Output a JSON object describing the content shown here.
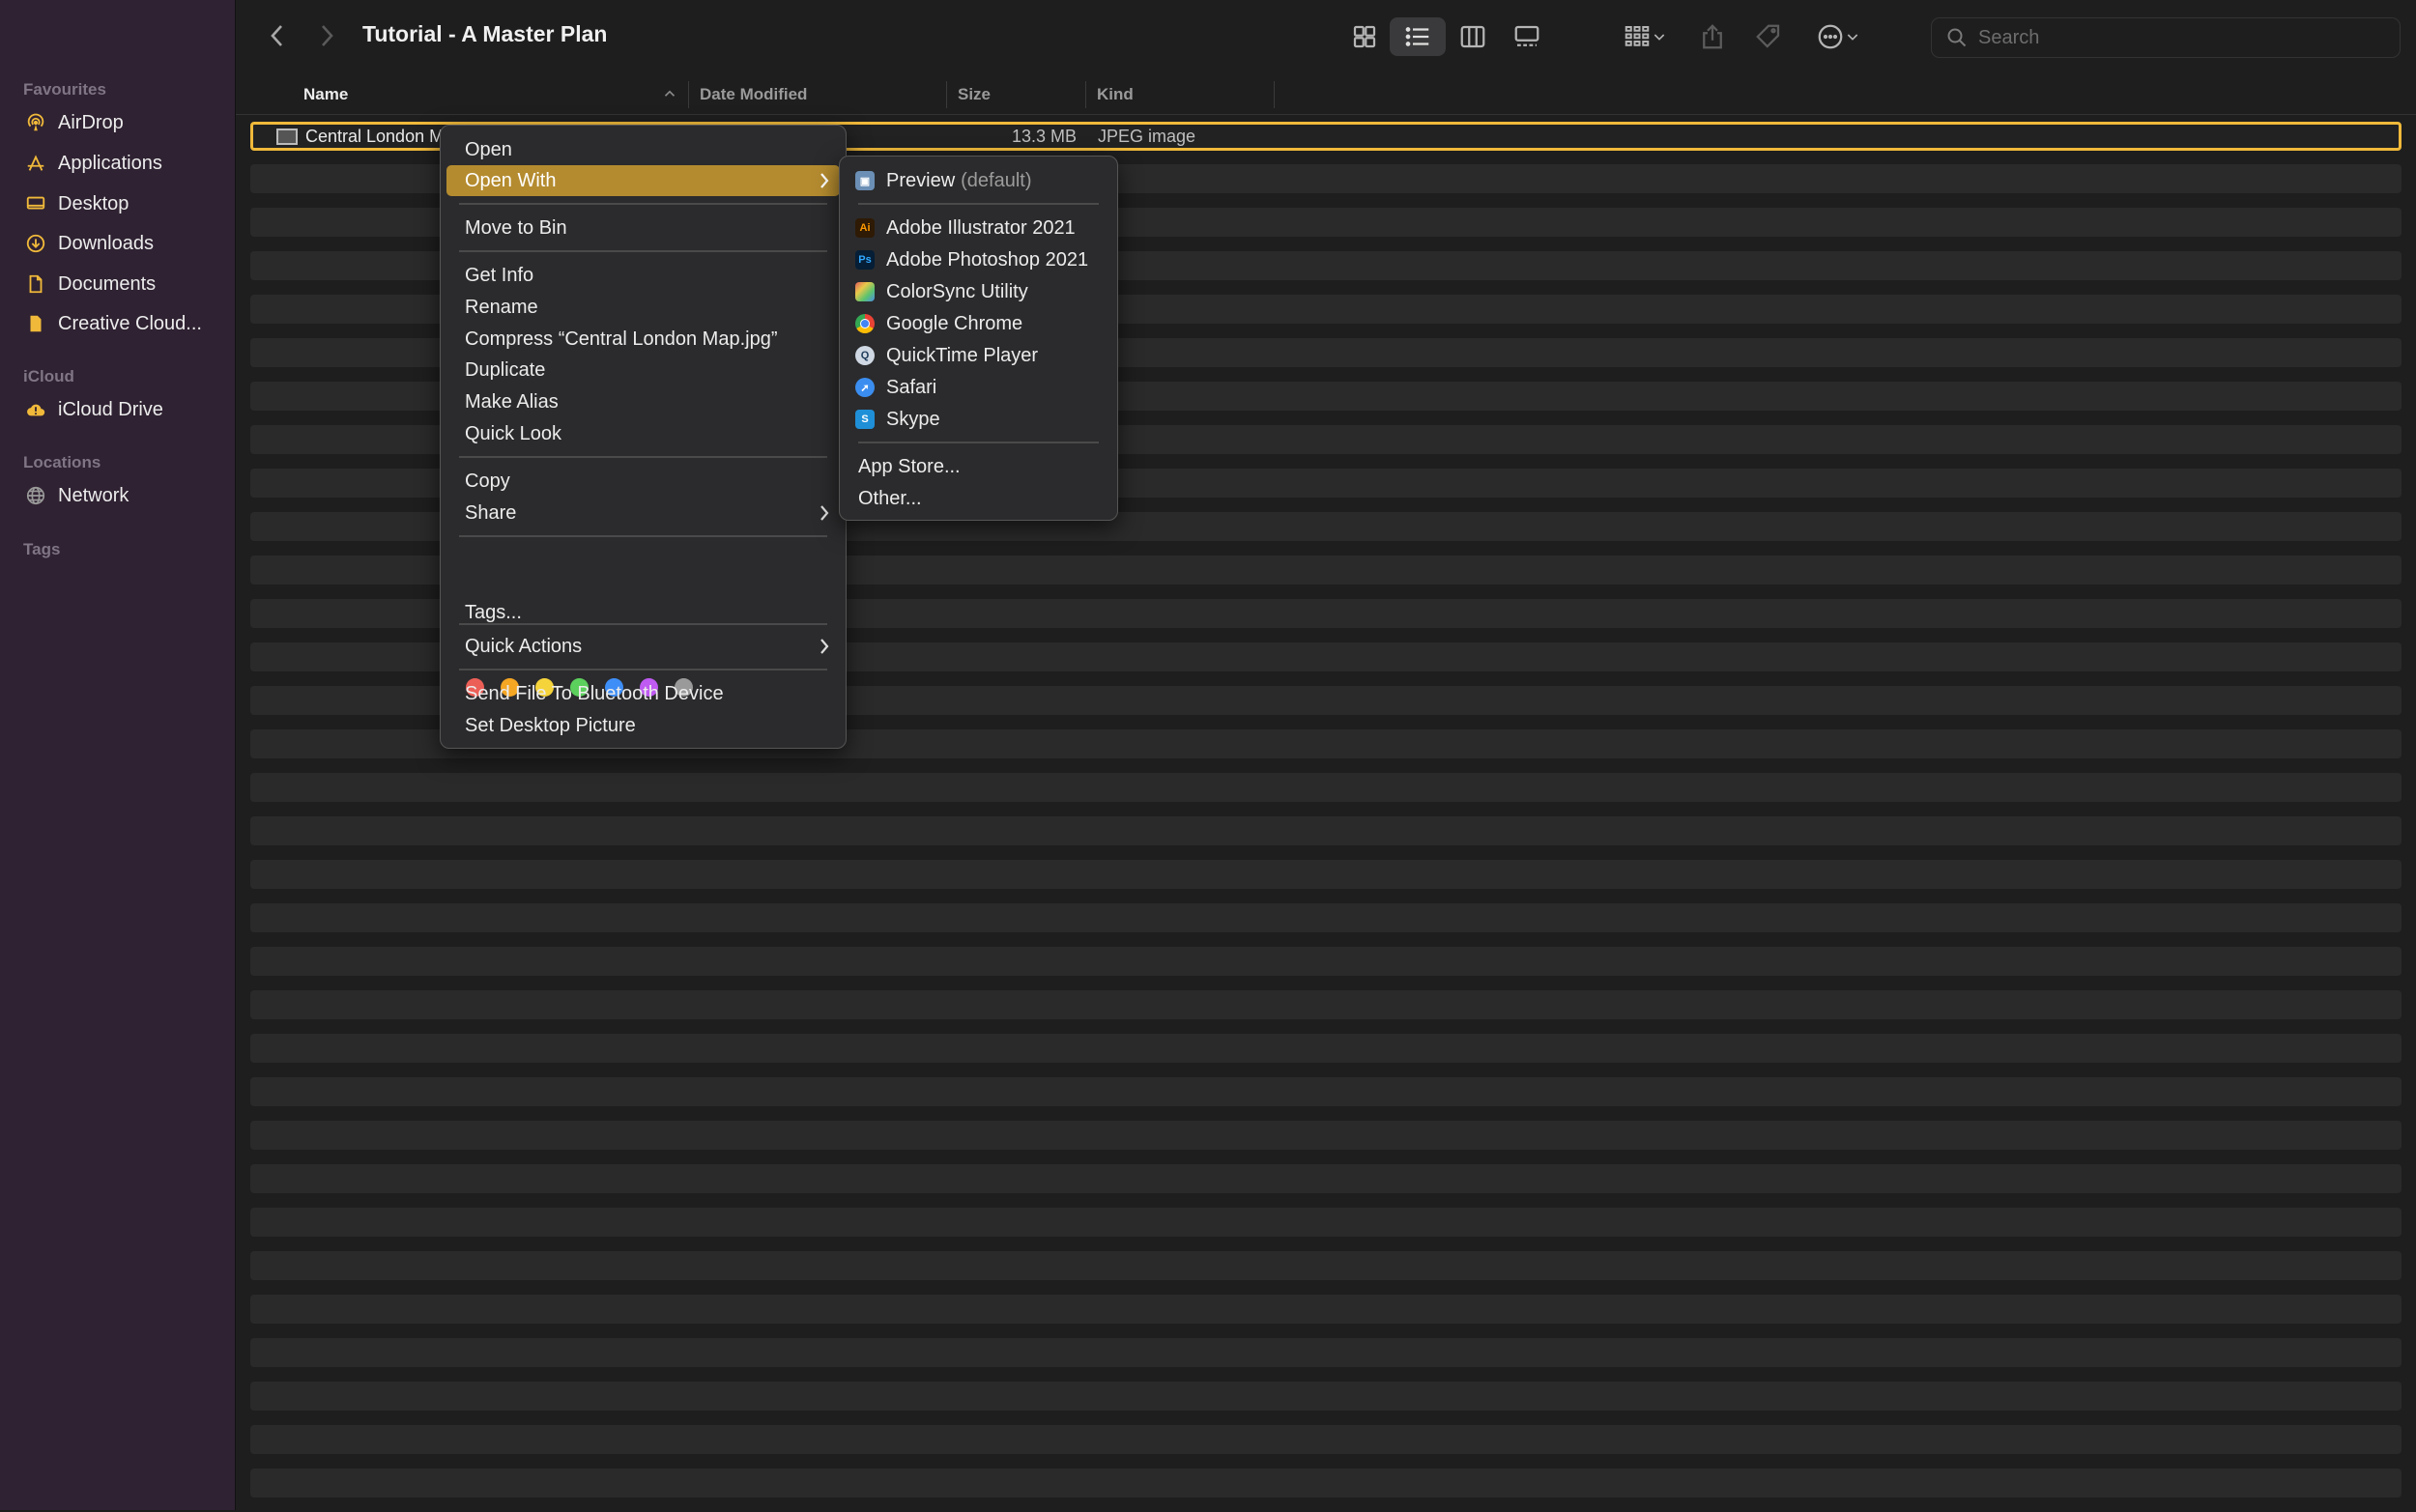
{
  "sidebar": {
    "favourites_label": "Favourites",
    "favourites": [
      {
        "label": "AirDrop",
        "icon": "airdrop-icon"
      },
      {
        "label": "Applications",
        "icon": "applications-icon"
      },
      {
        "label": "Desktop",
        "icon": "desktop-icon"
      },
      {
        "label": "Downloads",
        "icon": "downloads-icon"
      },
      {
        "label": "Documents",
        "icon": "documents-icon"
      },
      {
        "label": "Creative Cloud...",
        "icon": "folder-icon"
      }
    ],
    "icloud_label": "iCloud",
    "icloud": [
      {
        "label": "iCloud Drive",
        "icon": "cloud-icon"
      }
    ],
    "locations_label": "Locations",
    "locations": [
      {
        "label": "Network",
        "icon": "network-icon"
      }
    ],
    "tags_label": "Tags",
    "accent_color": "#f0b93a"
  },
  "toolbar": {
    "title": "Tutorial - A Master Plan",
    "search_placeholder": "Search",
    "view_mode": "list"
  },
  "columns": {
    "name": "Name",
    "date_modified": "Date Modified",
    "size": "Size",
    "kind": "Kind"
  },
  "files": [
    {
      "name": "Central London M",
      "size": "13.3 MB",
      "kind": "JPEG image",
      "selected": true
    }
  ],
  "context_menu": {
    "open": "Open",
    "open_with": "Open With",
    "move_to_bin": "Move to Bin",
    "get_info": "Get Info",
    "rename": "Rename",
    "compress": "Compress “Central London Map.jpg”",
    "duplicate": "Duplicate",
    "make_alias": "Make Alias",
    "quick_look": "Quick Look",
    "copy": "Copy",
    "share": "Share",
    "tag_colors": [
      "#ec5f57",
      "#f5a623",
      "#f5d33b",
      "#5cd05d",
      "#3e8ef7",
      "#bf5af2",
      "#9a9a9a"
    ],
    "tags": "Tags...",
    "quick_actions": "Quick Actions",
    "send_bluetooth": "Send File To Bluetooth Device",
    "set_desktop": "Set Desktop Picture",
    "highlight_color": "#b48b2f"
  },
  "open_with_menu": {
    "default_app": "Preview",
    "default_suffix": "(default)",
    "apps": [
      "Adobe Illustrator 2021",
      "Adobe Photoshop 2021",
      "ColorSync Utility",
      "Google Chrome",
      "QuickTime Player",
      "Safari",
      "Skype"
    ],
    "app_store": "App Store...",
    "other": "Other..."
  }
}
